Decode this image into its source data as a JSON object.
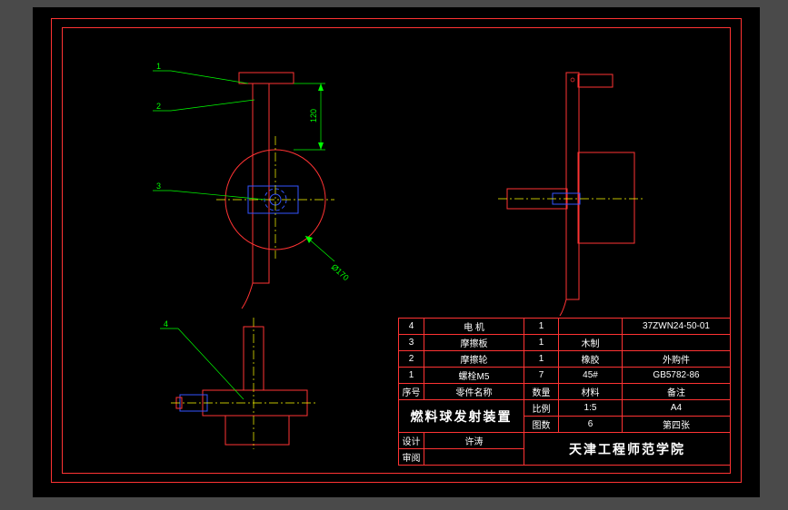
{
  "parts_list": {
    "headers": {
      "no": "序号",
      "name": "零件名称",
      "qty": "数量",
      "material": "材料",
      "note": "备注"
    },
    "rows": [
      {
        "no": "4",
        "name": "电 机",
        "qty": "1",
        "material": "",
        "note": "37ZWN24-50-01"
      },
      {
        "no": "3",
        "name": "摩擦板",
        "qty": "1",
        "material": "木制",
        "note": ""
      },
      {
        "no": "2",
        "name": "摩擦轮",
        "qty": "1",
        "material": "橡胶",
        "note": "外购件"
      },
      {
        "no": "1",
        "name": "螺栓M5",
        "qty": "7",
        "material": "45#",
        "note": "GB5782-86"
      }
    ]
  },
  "title": {
    "assembly_name": "燃料球发射装置",
    "scale_label": "比例",
    "scale_value": "1:5",
    "sheet_size": "A4",
    "sheets_label": "图数",
    "sheets_value": "6",
    "sheet_no": "第四张",
    "design_label": "设计",
    "designer": "许涛",
    "review_label": "审阅",
    "reviewer": "",
    "institution": "天津工程师范学院"
  },
  "dimensions": {
    "d1": "120",
    "d2": "Ø170"
  },
  "leaders": {
    "l1": "1",
    "l2": "2",
    "l3": "3",
    "l4": "4"
  }
}
